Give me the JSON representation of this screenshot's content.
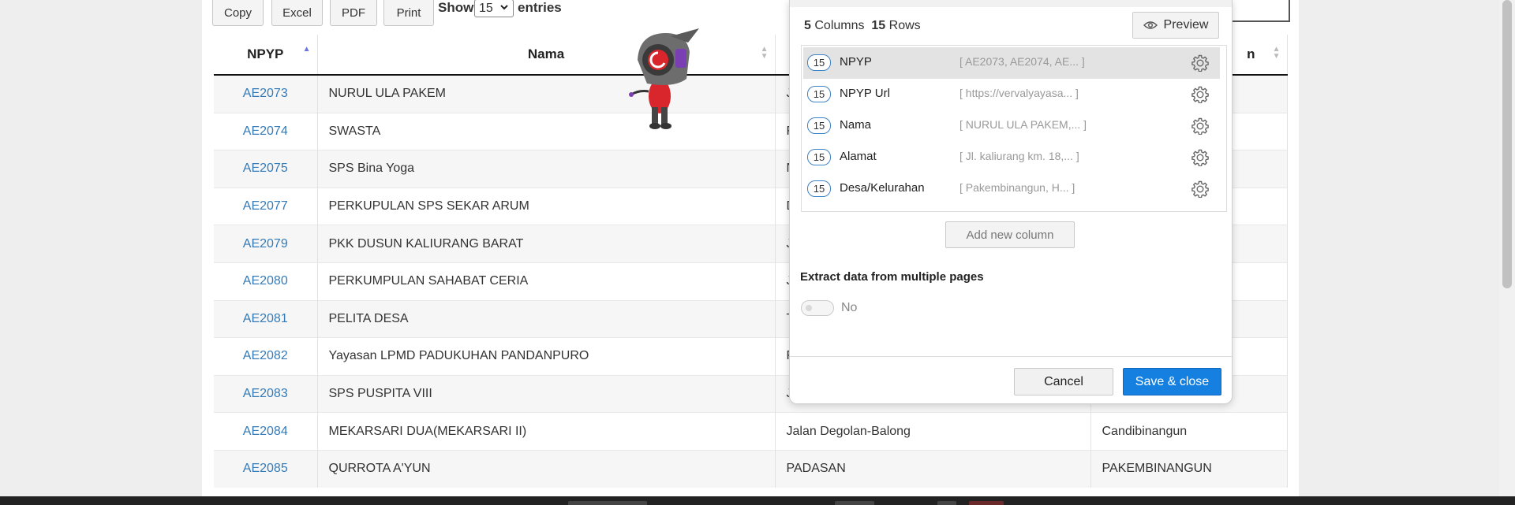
{
  "toolbar": {
    "buttons": [
      "Copy",
      "Excel",
      "PDF",
      "Print"
    ],
    "show_label": "Show",
    "entries_value": "15",
    "entries_label": "entries"
  },
  "table": {
    "headers": [
      "NPYP",
      "Nama",
      "",
      "n"
    ],
    "sorted_column": "NPYP",
    "rows": [
      [
        "AE2073",
        "NURUL ULA PAKEM",
        "J",
        ""
      ],
      [
        "AE2074",
        "SWASTA",
        "F",
        ""
      ],
      [
        "AE2075",
        "SPS Bina Yoga",
        "N",
        ""
      ],
      [
        "AE2077",
        "PERKUPULAN SPS SEKAR ARUM",
        "D",
        ""
      ],
      [
        "AE2079",
        "PKK DUSUN KALIURANG BARAT",
        "J",
        ""
      ],
      [
        "AE2080",
        "PERKUMPULAN SAHABAT CERIA",
        "J",
        ""
      ],
      [
        "AE2081",
        "PELITA DESA",
        "T",
        ""
      ],
      [
        "AE2082",
        "Yayasan LPMD PADUKUHAN PANDANPURO",
        "F",
        ""
      ],
      [
        "AE2083",
        "SPS PUSPITA VIII",
        "J",
        ""
      ],
      [
        "AE2084",
        "MEKARSARI DUA(MEKARSARI II)",
        "Jalan Degolan-Balong",
        "Candibinangun"
      ],
      [
        "AE2085",
        "QURROTA A'YUN",
        "PADASAN",
        "PAKEMBINANGUN"
      ]
    ]
  },
  "modal": {
    "columns_count": "5",
    "columns_word": "Columns",
    "rows_count": "15",
    "rows_word": "Rows",
    "preview_label": "Preview",
    "columns": [
      {
        "count": "15",
        "name": "NPYP",
        "preview": "[ AE2073, AE2074, AE... ]",
        "selected": true
      },
      {
        "count": "15",
        "name": "NPYP Url",
        "preview": "[ https://vervalyayasa... ]",
        "selected": false
      },
      {
        "count": "15",
        "name": "Nama",
        "preview": "[ NURUL ULA PAKEM,... ]",
        "selected": false
      },
      {
        "count": "15",
        "name": "Alamat",
        "preview": "[ Jl. kaliurang km. 18,... ]",
        "selected": false
      },
      {
        "count": "15",
        "name": "Desa/Kelurahan",
        "preview": "[ Pakembinangun, H... ]",
        "selected": false
      }
    ],
    "add_column_label": "Add new column",
    "extract_label": "Extract data from multiple pages",
    "toggle_label": "No",
    "cancel_label": "Cancel",
    "save_label": "Save & close"
  },
  "colors": {
    "link": "#337ab7",
    "primary": "#1680e0",
    "badge_border": "#3d82c4",
    "sort_active": "#6b74d8"
  }
}
